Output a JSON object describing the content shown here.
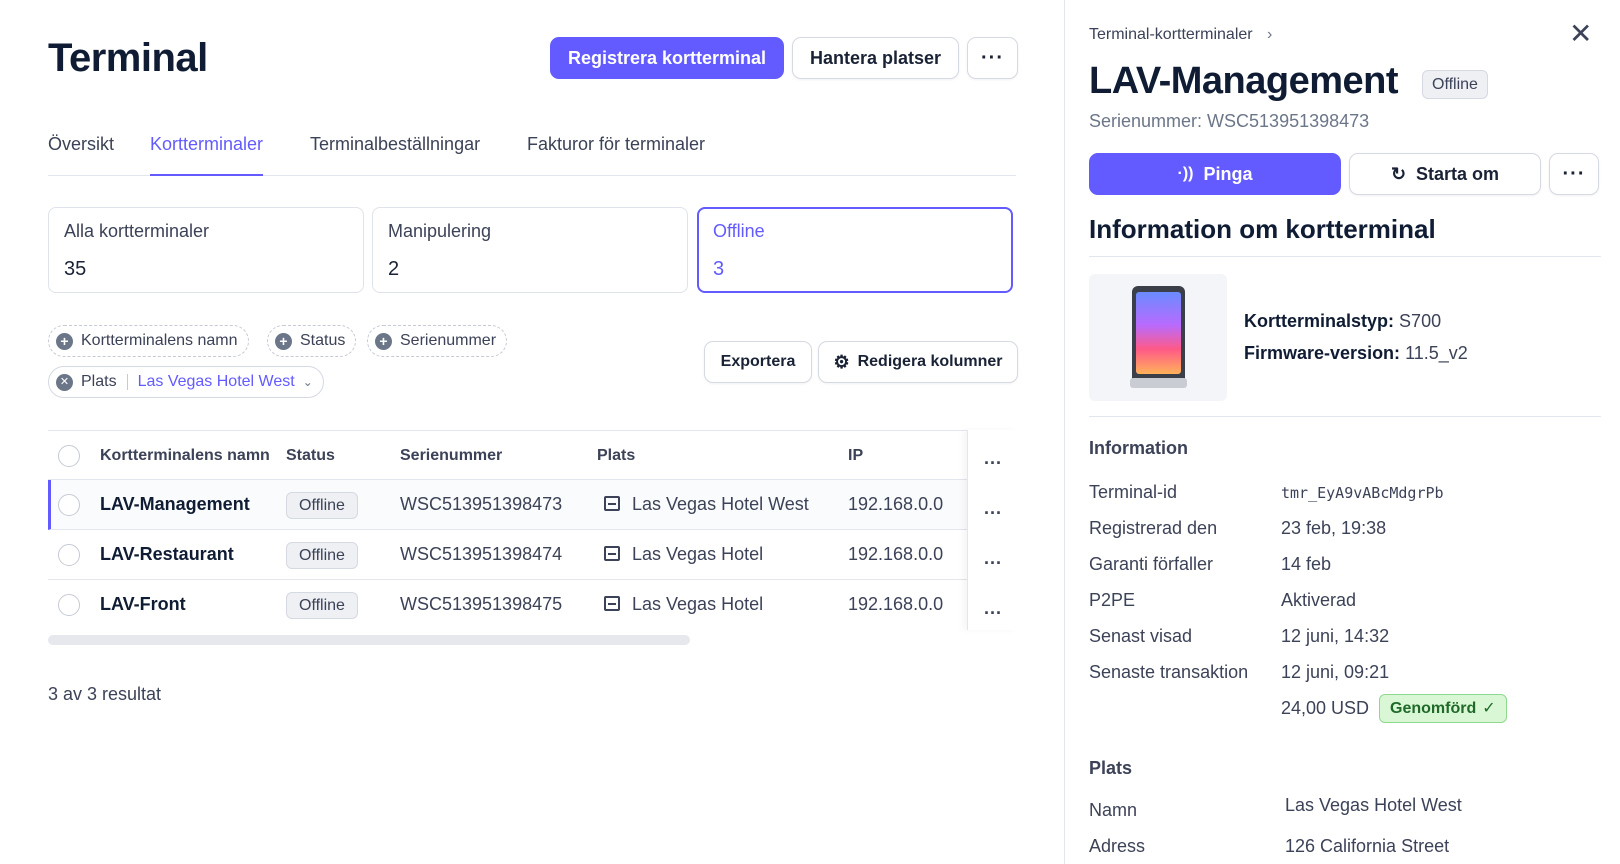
{
  "main": {
    "title": "Terminal",
    "buttons": {
      "register": "Registrera kortterminal",
      "places": "Hantera platser",
      "more": "···"
    },
    "tabs": [
      "Översikt",
      "Kortterminaler",
      "Terminalbeställningar",
      "Fakturor för terminaler"
    ],
    "active_tab": "Kortterminaler",
    "stats": [
      {
        "label": "Alla kortterminaler",
        "count": "35"
      },
      {
        "label": "Manipulering",
        "count": "2"
      },
      {
        "label": "Offline",
        "count": "3"
      }
    ],
    "filters": {
      "chips": [
        "Kortterminalens namn",
        "Status",
        "Serienummer"
      ],
      "location_label": "Plats",
      "location_value": "Las Vegas Hotel West"
    },
    "actions": {
      "export": "Exportera",
      "edit_columns": "Redigera kolumner"
    },
    "table": {
      "headers": [
        "Kortterminalens namn",
        "Status",
        "Serienummer",
        "Plats",
        "IP"
      ],
      "rows": [
        {
          "name": "LAV-Management",
          "status": "Offline",
          "serial": "WSC513951398473",
          "location": "Las Vegas Hotel West",
          "ip": "192.168.0.0"
        },
        {
          "name": "LAV-Restaurant",
          "status": "Offline",
          "serial": "WSC513951398474",
          "location": "Las Vegas Hotel",
          "ip": "192.168.0.0"
        },
        {
          "name": "LAV-Front",
          "status": "Offline",
          "serial": "WSC513951398475",
          "location": "Las Vegas Hotel",
          "ip": "192.168.0.0"
        }
      ],
      "row_menu": "...",
      "results": "3 av 3 resultat"
    }
  },
  "panel": {
    "breadcrumb": "Terminal-kortterminaler",
    "breadcrumb_chevron": "›",
    "close": "✕",
    "title": "LAV-Management",
    "badge": "Offline",
    "serial": "Serienummer: WSC513951398473",
    "buttons": {
      "ping": "Pinga",
      "restart": "Starta om",
      "more": "···"
    },
    "section_title": "Information om kortterminal",
    "device": {
      "type_label": "Kortterminalstyp:",
      "type_value": "S700",
      "firmware_label": "Firmware-version:",
      "firmware_value": "11.5_v2"
    },
    "info": {
      "title": "Information",
      "rows": [
        {
          "label": "Terminal-id",
          "value": "tmr_EyA9vABcMdgrPb"
        },
        {
          "label": "Registrerad den",
          "value": "23 feb, 19:38"
        },
        {
          "label": "Garanti förfaller",
          "value": "14 feb"
        },
        {
          "label": "P2PE",
          "value": "Aktiverad"
        },
        {
          "label": "Senast visad",
          "value": "12 juni, 14:32"
        },
        {
          "label": "Senaste transaktion",
          "value": "12 juni, 09:21"
        }
      ],
      "amount": "24,00 USD",
      "amount_status": "Genomförd"
    },
    "place": {
      "title": "Plats",
      "rows": [
        {
          "label": "Namn",
          "value": "Las Vegas Hotel West"
        },
        {
          "label": "Adress",
          "value": "126 California Street"
        }
      ]
    }
  },
  "colors": {
    "accent": "#635bff",
    "success_bg": "#d9f7d4",
    "badge_bg": "#eef0f4"
  },
  "icons": [
    "plus-circle-icon",
    "close-circle-icon",
    "chevron-down-icon",
    "gear-icon",
    "store-icon",
    "ping-icon",
    "restart-icon",
    "close-icon",
    "check-icon",
    "ellipsis-icon"
  ]
}
